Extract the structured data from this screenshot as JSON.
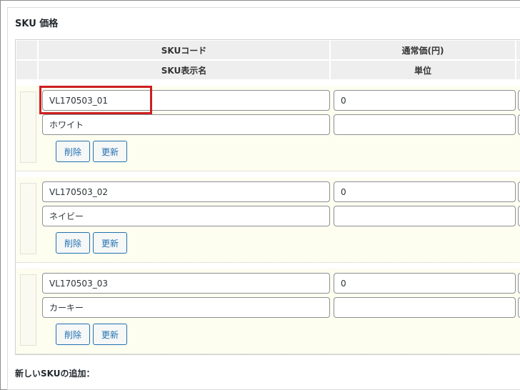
{
  "section": {
    "title": "SKU 価格"
  },
  "header": {
    "col_code": "SKUコード",
    "col_price": "通常価(円)",
    "col_name": "SKU表示名",
    "col_unit": "単位"
  },
  "skus": [
    {
      "code": "VL170503_01",
      "price": "0",
      "name": "ホワイト",
      "unit": ""
    },
    {
      "code": "VL170503_02",
      "price": "0",
      "name": "ネイビー",
      "unit": ""
    },
    {
      "code": "VL170503_03",
      "price": "0",
      "name": "カーキー",
      "unit": ""
    }
  ],
  "buttons": {
    "delete_label": "削除",
    "update_label": "更新"
  },
  "add_section": {
    "title": "新しいSKUの追加："
  },
  "colors": {
    "accent": "#2271b1",
    "highlight": "#cc1f1f",
    "row_bg": "#fdfdf0"
  }
}
